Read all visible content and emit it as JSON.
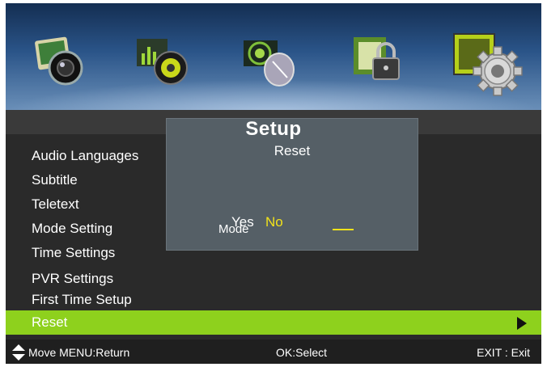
{
  "header": {
    "title": "Setup",
    "icons": [
      {
        "name": "picture-icon"
      },
      {
        "name": "sound-icon"
      },
      {
        "name": "channel-icon"
      },
      {
        "name": "lock-icon"
      },
      {
        "name": "setup-gear-icon",
        "selected": true
      }
    ]
  },
  "menu": {
    "items": [
      {
        "label": "Audio  Languages"
      },
      {
        "label": "Subtitle"
      },
      {
        "label": "Teletext"
      },
      {
        "label": "Mode Setting"
      },
      {
        "label": "Time Settings"
      },
      {
        "label": "PVR Settings"
      },
      {
        "label": "First Time Setup"
      },
      {
        "label": "Reset",
        "active": true
      }
    ]
  },
  "dialog": {
    "title": "Reset",
    "yes": "Yes",
    "no": "No",
    "ghost_text": "Mode"
  },
  "footer": {
    "move": "Move MENU:Return",
    "ok": "OK:Select",
    "exit": "EXIT : Exit"
  },
  "colors": {
    "highlight": "#8ed11d",
    "selected_option": "#f2e21a",
    "dialog_bg": "#555f66"
  }
}
